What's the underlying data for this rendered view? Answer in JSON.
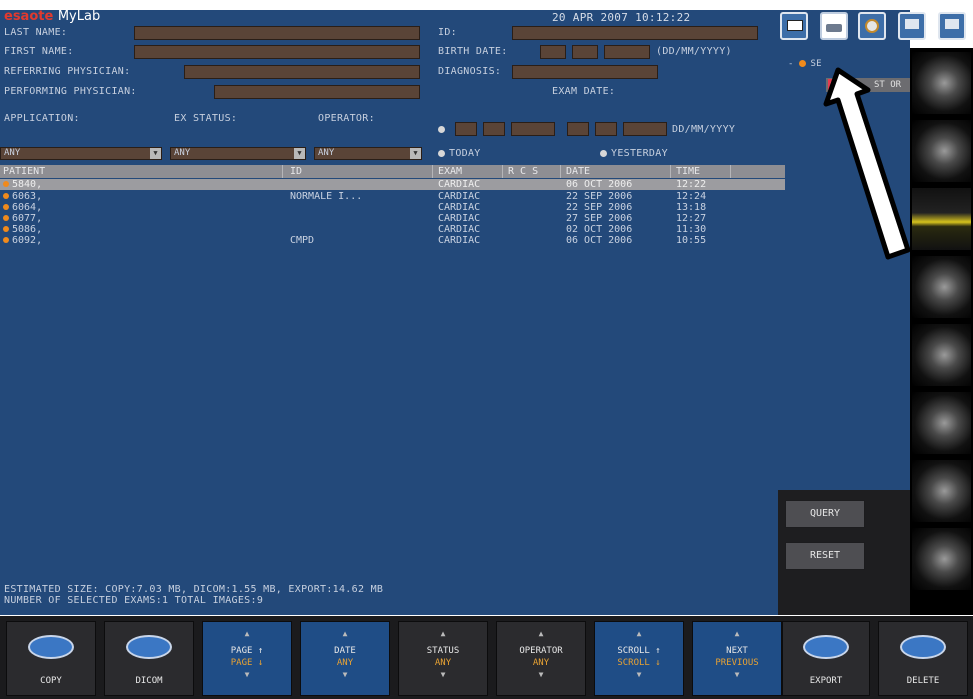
{
  "brand": {
    "part1": "esaote",
    "part2": "MyLab"
  },
  "datetime": "20 APR 2007 10:12:22",
  "fields": {
    "last_name": "LAST NAME:",
    "first_name": "FIRST NAME:",
    "referring": "REFERRING PHYSICIAN:",
    "performing": "PERFORMING PHYSICIAN:",
    "id": "ID:",
    "birth_date": "BIRTH DATE:",
    "date_format": "(DD/MM/YYYY)",
    "diagnosis": "DIAGNOSIS:",
    "exam_date": "EXAM DATE:",
    "exam_date_format": "DD/MM/YYYY",
    "application": "APPLICATION:",
    "ex_status": "EX STATUS:",
    "operator": "OPERATOR:",
    "today": "TODAY",
    "yesterday": "YESTERDAY"
  },
  "selects": {
    "application": "ANY",
    "ex_status": "ANY",
    "operator": "ANY"
  },
  "right_panel": {
    "item1": "SE",
    "item2": "C",
    "item3": "ST OR"
  },
  "table": {
    "headers": [
      "PATIENT",
      "ID",
      "EXAM",
      "R C S",
      "DATE",
      "TIME"
    ],
    "rows": [
      {
        "patient": "5840,",
        "id": "",
        "exam": "CARDIAC",
        "date": "06 OCT 2006",
        "time": "12:22"
      },
      {
        "patient": "6063,",
        "id": "NORMALE I...",
        "exam": "CARDIAC",
        "date": "22 SEP 2006",
        "time": "12:24"
      },
      {
        "patient": "6064,",
        "id": "",
        "exam": "CARDIAC",
        "date": "22 SEP 2006",
        "time": "13:18"
      },
      {
        "patient": "6077,",
        "id": "",
        "exam": "CARDIAC",
        "date": "27 SEP 2006",
        "time": "12:27"
      },
      {
        "patient": "5086,",
        "id": "",
        "exam": "CARDIAC",
        "date": "02 OCT 2006",
        "time": "11:30"
      },
      {
        "patient": "6092,",
        "id": "CMPD",
        "exam": "CARDIAC",
        "date": "06 OCT 2006",
        "time": "10:55"
      }
    ]
  },
  "buttons": {
    "query": "QUERY",
    "reset": "RESET"
  },
  "status": {
    "line1": "ESTIMATED SIZE: COPY:7.03 MB, DICOM:1.55 MB, EXPORT:14.62 MB",
    "line2": "NUMBER OF SELECTED EXAMS:1  TOTAL IMAGES:9"
  },
  "function_keys": [
    {
      "label": "COPY"
    },
    {
      "label": "DICOM"
    },
    {
      "l1": "PAGE ↑",
      "l2": "PAGE ↓"
    },
    {
      "l1": "DATE",
      "l2": "ANY"
    },
    {
      "l1": "STATUS",
      "l2": "ANY"
    },
    {
      "l1": "OPERATOR",
      "l2": "ANY"
    },
    {
      "l1": "SCROLL ↑",
      "l2": "SCROLL ↓"
    },
    {
      "l1": "NEXT",
      "l2": "PREVIOUS"
    },
    {
      "label": "EXPORT"
    },
    {
      "label": "DELETE"
    }
  ],
  "colors": {
    "panel": "#23497a",
    "field": "#5a4437",
    "accent": "#f08a1c",
    "header": "#8e8e93"
  },
  "icons": [
    "monitor-icon",
    "printer-icon",
    "disc-icon",
    "network-icon",
    "archive-icon"
  ]
}
